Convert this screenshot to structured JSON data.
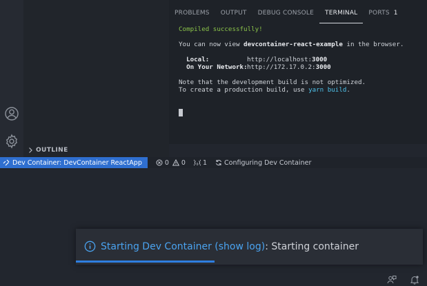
{
  "panel": {
    "tabs": [
      {
        "label": "PROBLEMS"
      },
      {
        "label": "OUTPUT"
      },
      {
        "label": "DEBUG CONSOLE"
      },
      {
        "label": "TERMINAL",
        "active": true
      },
      {
        "label": "PORTS",
        "count": "1"
      }
    ]
  },
  "terminal": {
    "compiled": "Compiled successfully!",
    "view_prefix": "You can now view ",
    "app_name": "devcontainer-react-example",
    "view_suffix": " in the browser.",
    "local_label": "  Local:",
    "local_url_prefix": "http://localhost:",
    "local_port": "3000",
    "network_label": "  On Your Network:",
    "network_url_prefix": "http://172.17.0.2:",
    "network_port": "3000",
    "note_line1": "Note that the development build is not optimized.",
    "note_line2_prefix": "To create a production build, use ",
    "note_cmd": "yarn build",
    "note_line2_suffix": "."
  },
  "sidebar": {
    "outline_label": "OUTLINE"
  },
  "statusbar": {
    "remote_label": "Dev Container: DevContainer ReactApp",
    "errors": "0",
    "warnings": "0",
    "ports_count": "1",
    "task_label": "Configuring Dev Container"
  },
  "notification": {
    "link_text": "Starting Dev Container (show log)",
    "message": ": Starting container",
    "progress": 0.4
  },
  "colors": {
    "accent": "#2f6fd0",
    "link": "#4aa3f0",
    "success": "#8bc34a"
  },
  "icons": {
    "account": "account-icon",
    "settings": "gear-icon",
    "feedback": "feedback-icon",
    "bell": "bell-icon"
  }
}
